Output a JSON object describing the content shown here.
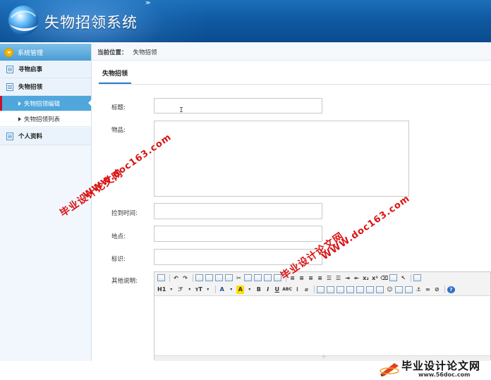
{
  "header": {
    "app_title": "失物招领系统",
    "marker": "≫"
  },
  "sidebar": {
    "section_title": "系统管理",
    "items": [
      {
        "label": "寻物启事"
      },
      {
        "label": "失物招领"
      },
      {
        "label": "失物招领编辑",
        "active": true
      },
      {
        "label": "失物招领列表"
      },
      {
        "label": "个人资料"
      }
    ]
  },
  "breadcrumb": {
    "label": "当前位置：",
    "current": "失物招领"
  },
  "tab": {
    "label": "失物招领"
  },
  "form": {
    "title_label": "标题:",
    "item_label": "物品:",
    "time_label": "捡到时间:",
    "place_label": "地点:",
    "mark_label": "标识:",
    "notes_label": "其他说明:"
  },
  "editor": {
    "h1_label": "H1",
    "font_label": "ℱ",
    "size_label": "тT",
    "a_label": "A",
    "b_label": "B",
    "i_label": "I",
    "u_label": "U",
    "abc_label": "ABC",
    "x_sub": "x₂",
    "x_sup": "x²",
    "help": "?"
  },
  "watermarks": {
    "cn": "毕业设计论文网",
    "url": "WWW.doc163.com"
  },
  "footer": {
    "brand": "毕业设计论文网",
    "url": "www.56doc.com"
  },
  "colors": {
    "header": "#0f5aa2",
    "sidebar_active": "#4fa7dc",
    "watermark": "#d91414"
  }
}
